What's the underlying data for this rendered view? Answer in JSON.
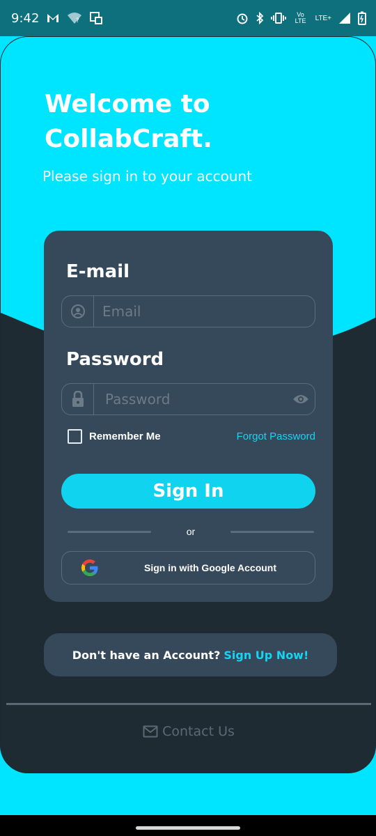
{
  "status_bar": {
    "time": "9:42",
    "left_icons": [
      "gmail-icon",
      "wifi-question-icon",
      "screenshot-icon"
    ],
    "right_icons": [
      "alarm-icon",
      "bluetooth-icon",
      "vibrate-icon",
      "volte-icon",
      "lte-plus-icon",
      "signal-icon",
      "battery-icon"
    ],
    "volte_text": "Vo LTE",
    "lte_text": "LTE+"
  },
  "header": {
    "title": "Welcome to CollabCraft.",
    "subtitle": "Please sign in to your account"
  },
  "form": {
    "email_label": "E-mail",
    "email_placeholder": "Email",
    "email_value": "",
    "password_label": "Password",
    "password_placeholder": "Password",
    "password_value": "",
    "remember_label": "Remember Me",
    "remember_checked": false,
    "forgot_label": "Forgot Password",
    "signin_label": "Sign In",
    "or_text": "or",
    "google_label": "Sign in with Google Account"
  },
  "signup": {
    "prompt": "Don't have an Account?",
    "link": "Sign Up Now!"
  },
  "footer": {
    "contact_label": "Contact Us",
    "contact_icon": "mail-icon"
  },
  "colors": {
    "accent": "#00e5ff",
    "status_bar": "#0e6f7d",
    "dark_bg": "#1f2b33",
    "card": "#36495a",
    "link": "#16d4f4",
    "button": "#0fd3ef"
  }
}
